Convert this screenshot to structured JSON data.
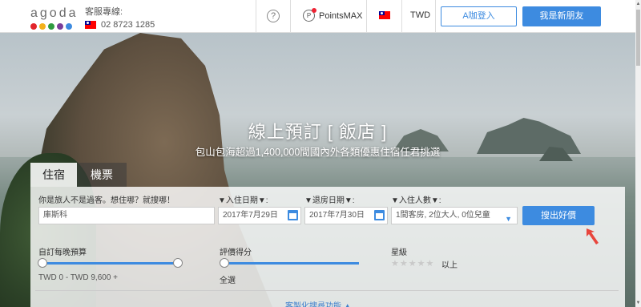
{
  "header": {
    "logo": "agoda",
    "logo_colors": [
      "#e2242b",
      "#f3b11b",
      "#2f9b40",
      "#7a3e9a",
      "#3d8be0"
    ],
    "hotline_label": "客服專線:",
    "hotline_number": "02 8723 1285",
    "help_icon": "?",
    "pointsmax": "PointsMAX",
    "currency": "TWD",
    "login": "A咖登入",
    "signup": "我是新朋友"
  },
  "hero": {
    "title": "線上預訂 [ 飯店 ]",
    "subtitle": "包山包海超過1,400,000間國內外各類優惠住宿任君挑選"
  },
  "tabs": [
    {
      "label": "住宿",
      "active": true
    },
    {
      "label": "機票",
      "active": false
    }
  ],
  "search": {
    "destination_label": "你是旅人不是過客。想住哪？就搜哪！",
    "destination_value": "庫斯科",
    "checkin_label": "▼入住日期▼:",
    "checkin_value": "2017年7月29日",
    "checkout_label": "▼退房日期▼:",
    "checkout_value": "2017年7月30日",
    "guests_label": "▼入住人數▼:",
    "guests_value": "1間客房, 2位大人, 0位兒童",
    "search_button": "搜出好價"
  },
  "filters": {
    "budget_label": "自訂每晚預算",
    "budget_range": "TWD 0 - TWD 9,600 +",
    "rating_label": "評價得分",
    "rating_value": "全選",
    "star_label": "星級",
    "star_suffix": "以上",
    "star_count": 5
  },
  "footer_link": "客製化搜尋功能 ▲"
}
